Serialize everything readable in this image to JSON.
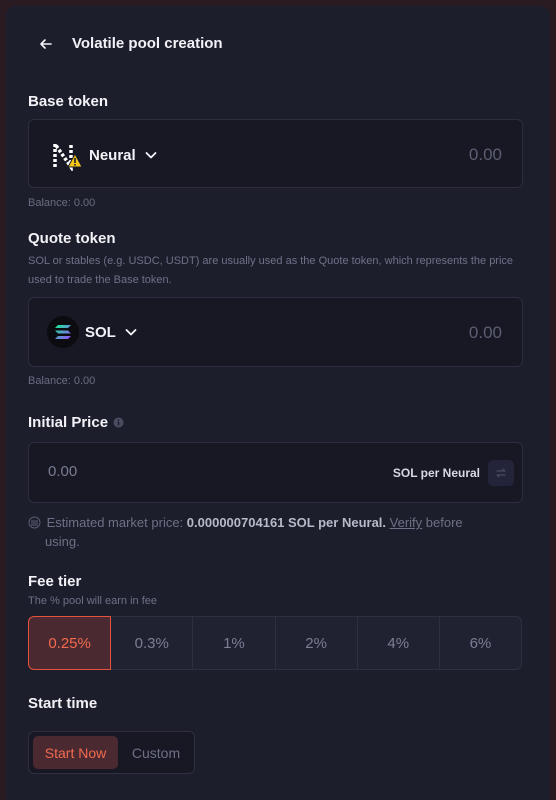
{
  "header": {
    "title": "Volatile pool creation",
    "back_icon": "arrow-left-icon"
  },
  "base_token": {
    "label": "Base token",
    "token_name": "Neural",
    "token_icon": "neural-token-icon",
    "warning_icon": "warning-icon",
    "amount_placeholder": "0.00",
    "balance": "Balance: 0.00"
  },
  "quote_token": {
    "label": "Quote token",
    "description": "SOL or stables (e.g. USDC, USDT) are usually used as the Quote token, which represents the price used to trade the Base token.",
    "token_name": "SOL",
    "token_icon": "solana-token-icon",
    "amount_placeholder": "0.00",
    "balance": "Balance: 0.00"
  },
  "initial_price": {
    "label": "Initial Price",
    "info_icon": "info-icon",
    "value_placeholder": "0.00",
    "unit": "SOL per Neural",
    "swap_icon": "swap-icon",
    "estimate_prefix": "Estimated market price:",
    "estimate_value": "0.000000704161 SOL per Neural.",
    "verify_link": "Verify",
    "estimate_suffix": "before",
    "estimate_tail": "using."
  },
  "fee_tier": {
    "label": "Fee tier",
    "description": "The % pool will earn in fee",
    "options": [
      "0.25%",
      "0.3%",
      "1%",
      "2%",
      "4%",
      "6%"
    ],
    "selected": "0.25%"
  },
  "start_time": {
    "label": "Start time",
    "start_now": "Start Now",
    "custom": "Custom"
  },
  "colors": {
    "accent": "#f36a4f",
    "panel": "#1d1e2c",
    "input_bg": "#171824"
  }
}
